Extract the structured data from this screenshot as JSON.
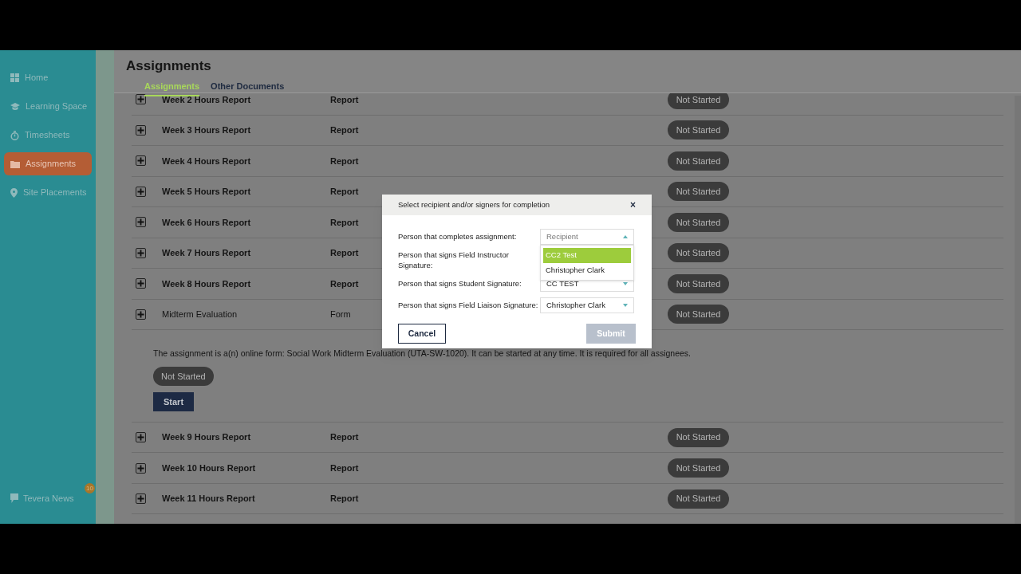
{
  "sidebar": {
    "items": [
      {
        "label": "Home",
        "selected": false
      },
      {
        "label": "Learning Space",
        "selected": false
      },
      {
        "label": "Timesheets",
        "selected": false
      },
      {
        "label": "Assignments",
        "selected": true
      },
      {
        "label": "Site Placements",
        "selected": false
      }
    ],
    "news": {
      "label": "Tevera News",
      "badge": "10"
    }
  },
  "page": {
    "title": "Assignments",
    "tabs": [
      {
        "label": "Assignments",
        "selected": true
      },
      {
        "label": "Other Documents",
        "selected": false
      }
    ]
  },
  "rows": [
    {
      "name": "Week 2 Hours Report",
      "type": "Report",
      "status": "Not Started",
      "expanded": false
    },
    {
      "name": "Week 3 Hours Report",
      "type": "Report",
      "status": "Not Started",
      "expanded": false
    },
    {
      "name": "Week 4 Hours Report",
      "type": "Report",
      "status": "Not Started",
      "expanded": false
    },
    {
      "name": "Week 5 Hours Report",
      "type": "Report",
      "status": "Not Started",
      "expanded": false
    },
    {
      "name": "Week 6 Hours Report",
      "type": "Report",
      "status": "Not Started",
      "expanded": false
    },
    {
      "name": "Week 7 Hours Report",
      "type": "Report",
      "status": "Not Started",
      "expanded": false
    },
    {
      "name": "Week 8 Hours Report",
      "type": "Report",
      "status": "Not Started",
      "expanded": false
    },
    {
      "name": "Midterm Evaluation",
      "type": "Form",
      "status": "Not Started",
      "expanded": true,
      "detail": {
        "text": "The assignment is a(n) online form: Social Work Midterm Evaluation (UTA-SW-1020). It can be started at any time. It is required for all assignees.",
        "status": "Not Started",
        "action": "Start"
      }
    },
    {
      "name": "Week 9 Hours Report",
      "type": "Report",
      "status": "Not Started",
      "expanded": false
    },
    {
      "name": "Week 10 Hours Report",
      "type": "Report",
      "status": "Not Started",
      "expanded": false
    },
    {
      "name": "Week 11 Hours Report",
      "type": "Report",
      "status": "Not Started",
      "expanded": false
    }
  ],
  "modal": {
    "title": "Select recipient and/or signers for completion",
    "close": "×",
    "fields": [
      {
        "label": "Person that completes assignment:",
        "select": true,
        "value": "Recipient",
        "placeholder": true,
        "open": true,
        "options": [
          {
            "label": "CC2 Test",
            "selected": true
          },
          {
            "label": "Christopher Clark",
            "selected": false
          }
        ]
      },
      {
        "label": "Person that signs Field Instructor Signature:"
      },
      {
        "label": "Person that signs Student Signature:",
        "select": true,
        "value": "CC TEST",
        "placeholder": false,
        "open": false
      },
      {
        "label": "Person that signs Field Liaison Signature:",
        "select": true,
        "value": "Christopher Clark",
        "placeholder": false,
        "open": false
      }
    ],
    "cancel": "Cancel",
    "submit": "Submit",
    "submit_disabled": true
  }
}
